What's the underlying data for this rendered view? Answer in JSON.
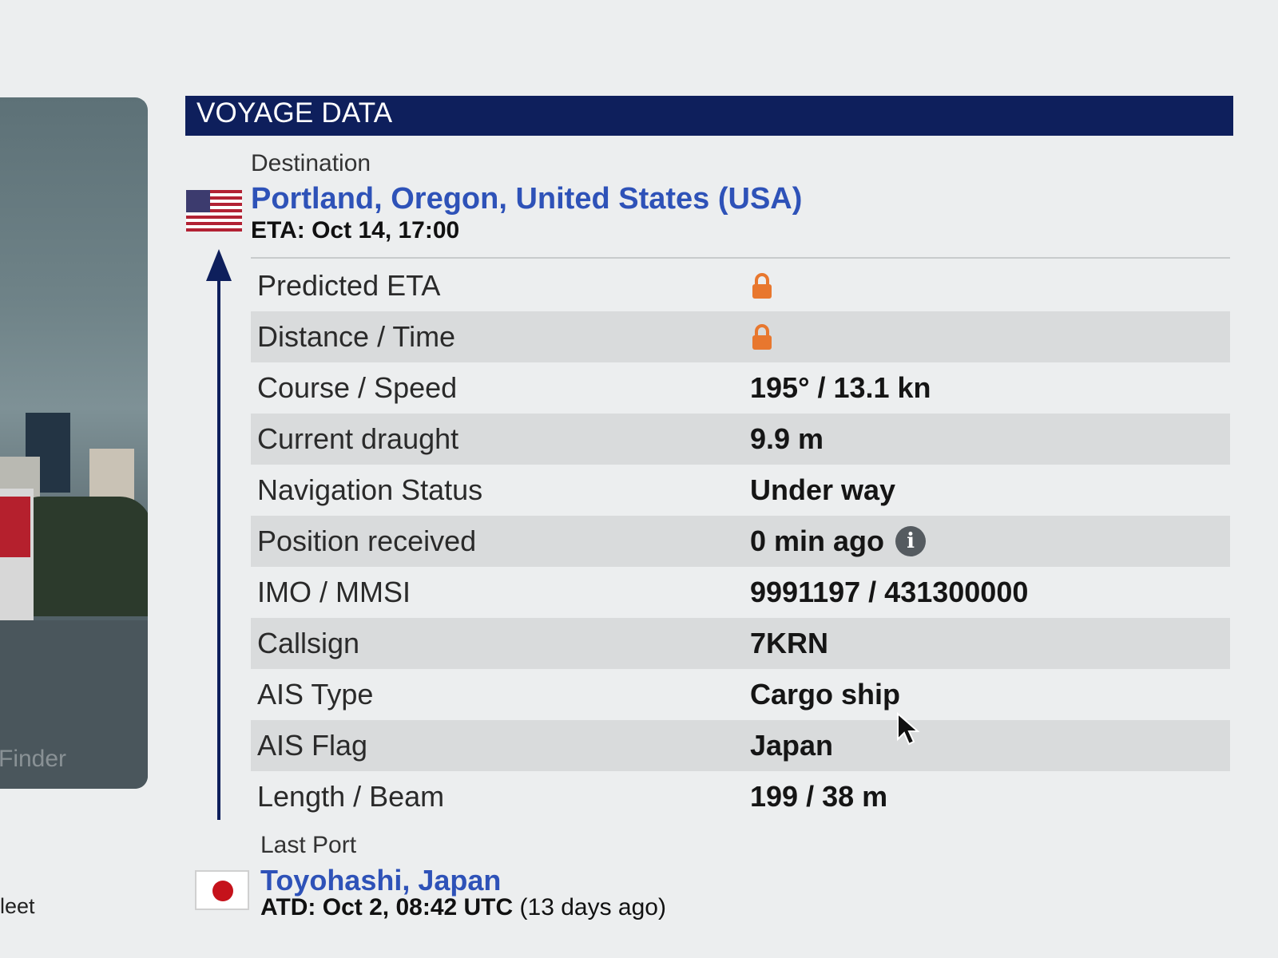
{
  "header": {
    "title": "VOYAGE DATA"
  },
  "destination": {
    "label": "Destination",
    "name": "Portland, Oregon, United States (USA)",
    "eta": "ETA: Oct 14, 17:00",
    "flag_icon": "us-flag-icon"
  },
  "rows": [
    {
      "label": "Predicted ETA",
      "value": "",
      "locked": true
    },
    {
      "label": "Distance / Time",
      "value": "",
      "locked": true
    },
    {
      "label": "Course / Speed",
      "value": "195° / 13.1 kn"
    },
    {
      "label": "Current draught",
      "value": "9.9 m"
    },
    {
      "label": "Navigation Status",
      "value": "Under way"
    },
    {
      "label": "Position received",
      "value": "0 min ago",
      "info_icon": true
    },
    {
      "label": "IMO / MMSI",
      "value": "9991197 / 431300000"
    },
    {
      "label": "Callsign",
      "value": "7KRN"
    },
    {
      "label": "AIS Type",
      "value": "Cargo ship"
    },
    {
      "label": "AIS Flag",
      "value": "Japan"
    },
    {
      "label": "Length / Beam",
      "value": "199 / 38 m"
    }
  ],
  "last_port": {
    "label": "Last Port",
    "name": "Toyohashi, Japan",
    "atd": "ATD: Oct 2, 08:42 UTC",
    "atd_ago": "(13 days ago)",
    "flag_icon": "japan-flag-icon"
  },
  "sidebar": {
    "fleet_label": "leet",
    "photo_watermark": "Finder"
  },
  "colors": {
    "header_bg": "#0e1f5c",
    "link": "#2e52b8",
    "lock": "#e8772e",
    "row_alt": "#d9dbdc"
  }
}
